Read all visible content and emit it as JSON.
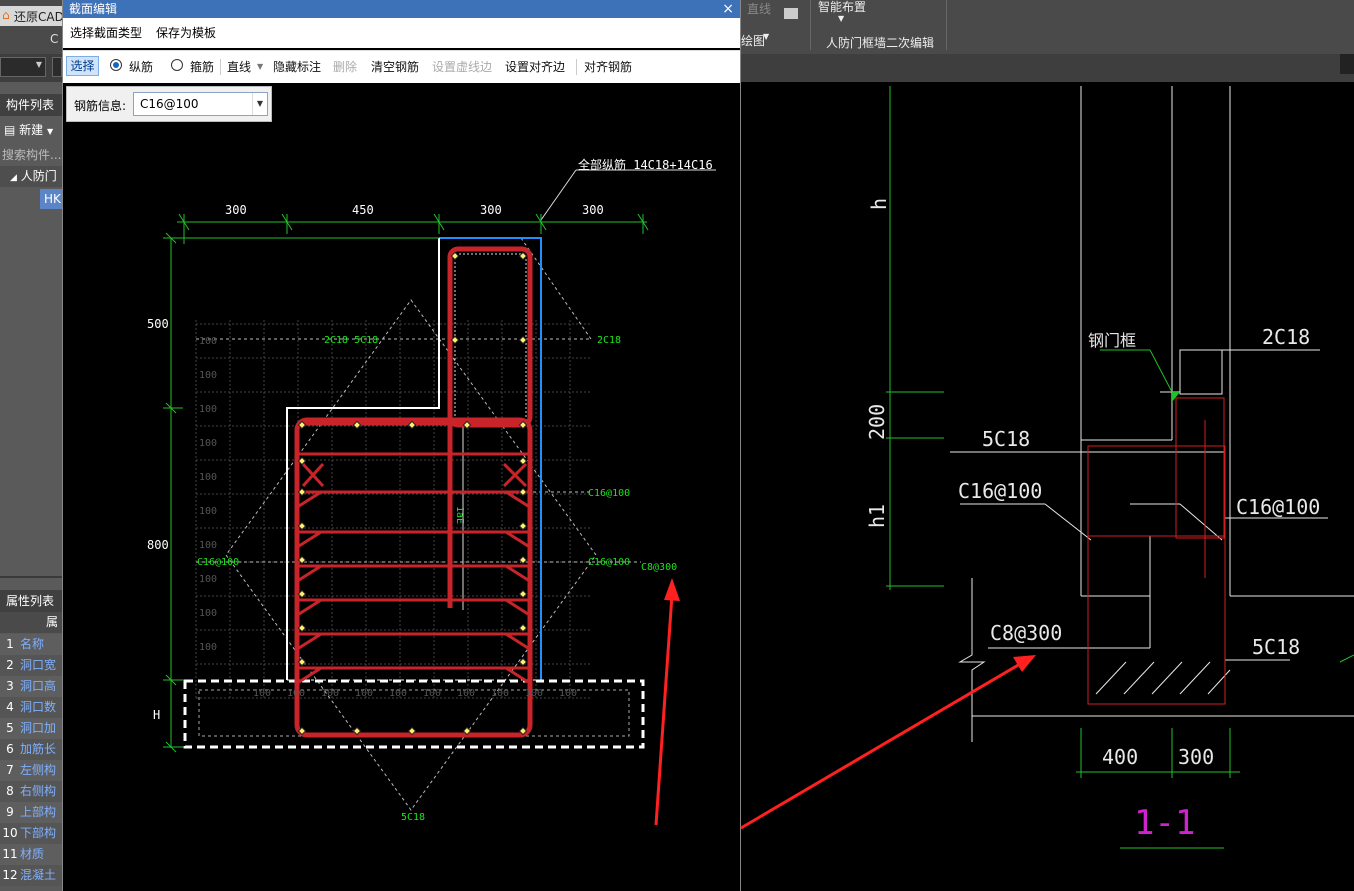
{
  "app": {
    "title_fragment": "还原CAD",
    "ribbon": {
      "c_label": "C",
      "line_label": "直线",
      "smart_layout": "智能布置",
      "drawing_label": "绘图",
      "civil_defense_edit": "人防门框墙二次编辑"
    },
    "left_panel": {
      "component_list": "构件列表",
      "new_button": "新建",
      "search_placeholder": "搜索构件...",
      "tree_item": "人防门",
      "tree_sub": "HK",
      "property_list": "属性列表",
      "prop_col": "属",
      "properties": [
        {
          "num": "1",
          "label": "名称"
        },
        {
          "num": "2",
          "label": "洞口宽"
        },
        {
          "num": "3",
          "label": "洞口高"
        },
        {
          "num": "4",
          "label": "洞口数"
        },
        {
          "num": "5",
          "label": "洞口加"
        },
        {
          "num": "6",
          "label": "加筋长"
        },
        {
          "num": "7",
          "label": "左侧构"
        },
        {
          "num": "8",
          "label": "右侧构"
        },
        {
          "num": "9",
          "label": "上部构"
        },
        {
          "num": "10",
          "label": "下部构"
        },
        {
          "num": "11",
          "label": "材质"
        },
        {
          "num": "12",
          "label": "混凝土"
        }
      ]
    }
  },
  "dialog": {
    "title": "截面编辑",
    "close": "×",
    "menu": {
      "select_section_type": "选择截面类型",
      "save_as_template": "保存为模板"
    },
    "toolbar": {
      "select": "选择",
      "longitudinal": "纵筋",
      "stirrup": "箍筋",
      "line": "直线",
      "hide_annotation": "隐藏标注",
      "delete": "删除",
      "clear_rebar": "清空钢筋",
      "set_dashed_edge": "设置虚线边",
      "set_align_edge": "设置对齐边",
      "align_rebar": "对齐钢筋"
    },
    "rebar_info": {
      "label": "钢筋信息:",
      "value": "C16@100"
    },
    "drawing": {
      "all_long_label": "全部纵筋 14C18+14C16",
      "dims_top": [
        "300",
        "450",
        "300",
        "300"
      ],
      "dim_500": "500",
      "dim_800": "800",
      "dim_H": "H",
      "grid_label": "100",
      "label_2c18_5c18": "2C18 5C18",
      "label_2c18": "2C18",
      "label_c16_1": "C16@100",
      "label_c16_2": "C16@100",
      "label_c16_left": "C16@100",
      "label_c8": "C8@300",
      "label_5c18": "5C18",
      "label_lae": "1aE"
    }
  },
  "reference": {
    "h": "h",
    "d200": "200",
    "h1": "h1",
    "steel_frame": "钢门框",
    "r2c18": "2C18",
    "r5c18_top": "5C18",
    "c16_left": "C16@100",
    "c16_right": "C16@100",
    "c8": "C8@300",
    "r5c18_bottom": "5C18",
    "d400": "400",
    "d300": "300",
    "section": "1-1"
  },
  "colors": {
    "title_bar": "#3e72b8",
    "rebar_red": "#c8242a",
    "dim_green": "#22c02a",
    "label_green": "#19e619",
    "outline_white": "#ffffff",
    "outline_blue": "#1e90ff",
    "section_magenta": "#d022d0",
    "arrow_red": "#ff2020"
  }
}
